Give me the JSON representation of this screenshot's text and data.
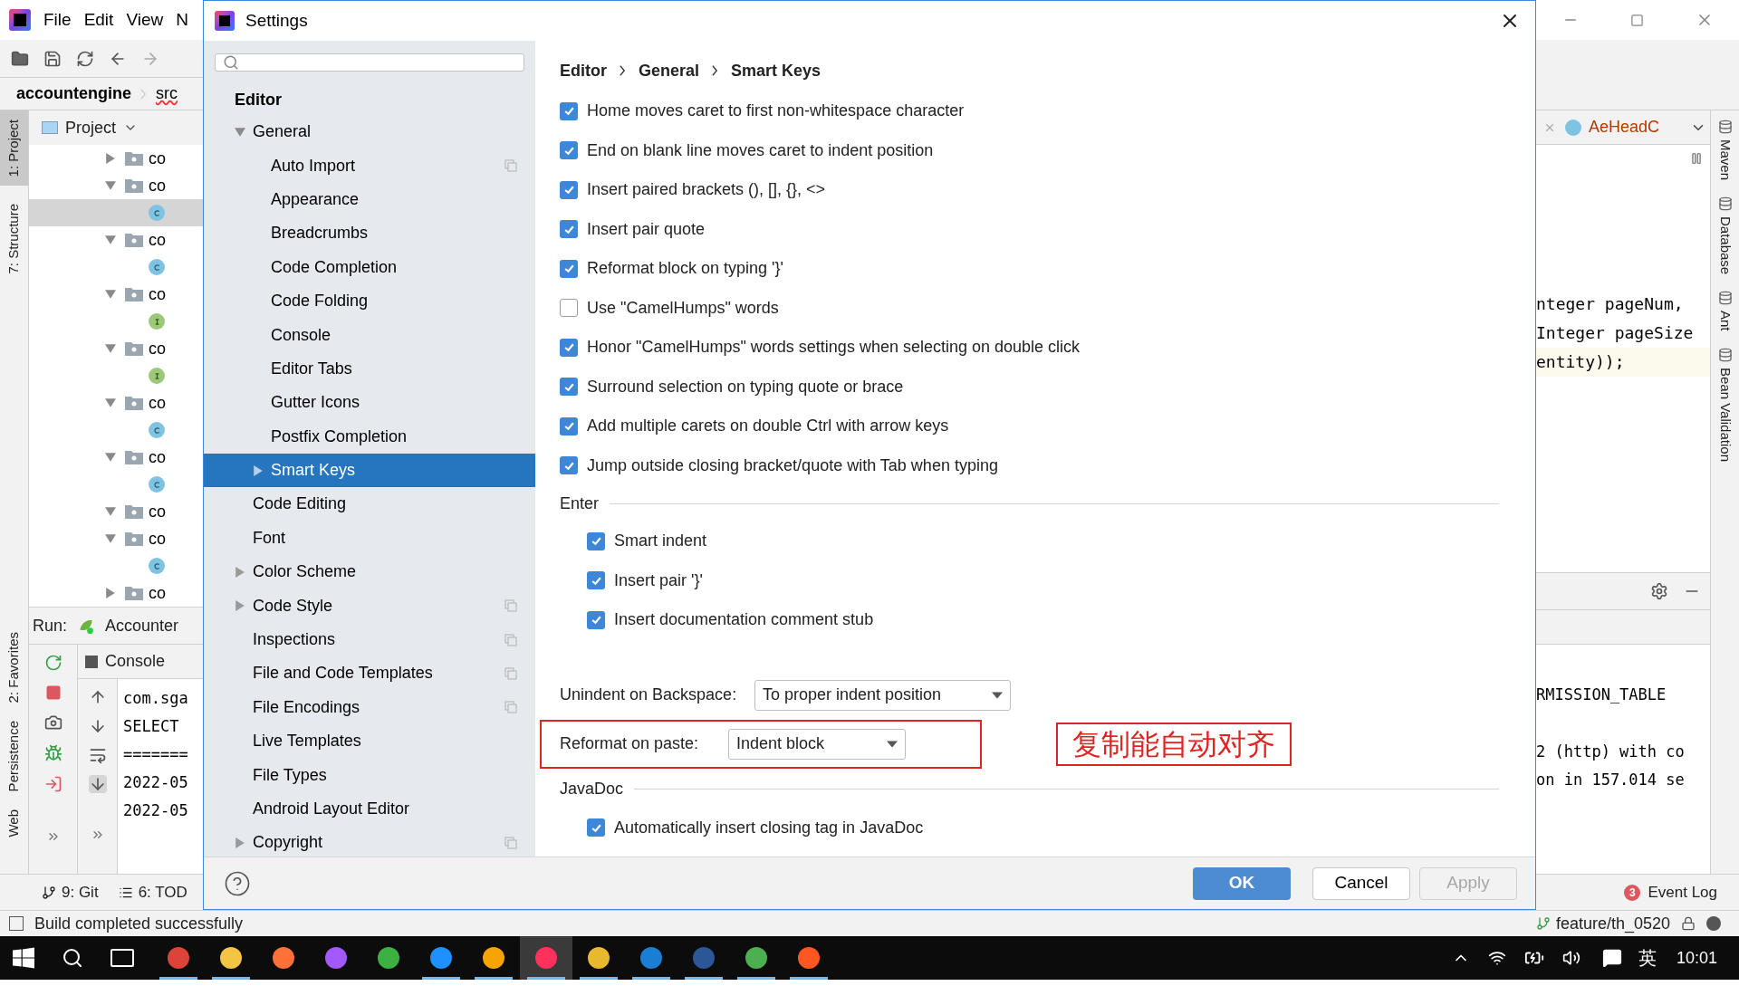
{
  "ide": {
    "menu": [
      "File",
      "Edit",
      "View",
      "N"
    ],
    "breadcrumbs": [
      "accountengine",
      "src"
    ],
    "left_stripe": [
      {
        "label": "1: Project",
        "selected": true
      },
      {
        "label": "7: Structure",
        "selected": false
      },
      {
        "label": "2: Favorites",
        "selected": false
      },
      {
        "label": "Persistence",
        "selected": false
      },
      {
        "label": "Web",
        "selected": false
      }
    ],
    "project_panel": {
      "title": "Project",
      "items": [
        {
          "kind": "folder",
          "label": "co",
          "expanded": false,
          "selected": false
        },
        {
          "kind": "folder",
          "label": "co",
          "expanded": true,
          "selected": false,
          "children": [
            {
              "kind": "class",
              "selected": true
            }
          ]
        },
        {
          "kind": "folder",
          "label": "co",
          "expanded": true,
          "selected": false,
          "children": [
            {
              "kind": "class",
              "selected": false
            }
          ]
        },
        {
          "kind": "folder",
          "label": "co",
          "expanded": true,
          "selected": false,
          "children": [
            {
              "kind": "interface",
              "selected": false
            }
          ]
        },
        {
          "kind": "folder",
          "label": "co",
          "expanded": true,
          "selected": false,
          "children": [
            {
              "kind": "interface",
              "selected": false
            }
          ]
        },
        {
          "kind": "folder",
          "label": "co",
          "expanded": true,
          "selected": false,
          "children": [
            {
              "kind": "class",
              "selected": false
            }
          ]
        },
        {
          "kind": "folder",
          "label": "co",
          "expanded": true,
          "selected": false,
          "children": [
            {
              "kind": "class",
              "selected": false
            }
          ]
        },
        {
          "kind": "folder",
          "label": "co",
          "expanded": true,
          "selected": false
        },
        {
          "kind": "folder",
          "label": "co",
          "expanded": true,
          "selected": false,
          "children": [
            {
              "kind": "class",
              "selected": false
            }
          ]
        },
        {
          "kind": "folder",
          "label": "co",
          "expanded": false,
          "selected": false
        }
      ]
    },
    "run": {
      "label": "Run:",
      "config": "Accounter",
      "console_tab": "Console",
      "lines": [
        "com.sga",
        "SELECT",
        "=======",
        "2022-05",
        "2022-05"
      ]
    },
    "bottom_tabs": [
      "9: Git",
      "6: TOD"
    ],
    "editor": {
      "tab": "AeHeadC",
      "code": [
        "nteger pageNum,",
        "Integer pageSize",
        "entity));"
      ]
    },
    "right_stripe": [
      "Maven",
      "Database",
      "Ant",
      "Bean Validation"
    ],
    "console_right": [
      "RMISSION_TABLE",
      "2 (http) with co",
      "on in 157.014 se"
    ],
    "event_log": {
      "count": "3",
      "label": "Event Log"
    },
    "status": {
      "message": "Build completed successfully",
      "branch": "feature/th_0520"
    }
  },
  "dialog": {
    "title": "Settings",
    "tree": {
      "heading": "Editor",
      "items": [
        {
          "label": "General",
          "expanded": true,
          "selected": false,
          "shared": false,
          "children": [
            {
              "label": "Auto Import",
              "selected": false,
              "shared": true
            },
            {
              "label": "Appearance",
              "selected": false,
              "shared": false
            },
            {
              "label": "Breadcrumbs",
              "selected": false,
              "shared": false
            },
            {
              "label": "Code Completion",
              "selected": false,
              "shared": false
            },
            {
              "label": "Code Folding",
              "selected": false,
              "shared": false
            },
            {
              "label": "Console",
              "selected": false,
              "shared": false
            },
            {
              "label": "Editor Tabs",
              "selected": false,
              "shared": false
            },
            {
              "label": "Gutter Icons",
              "selected": false,
              "shared": false
            },
            {
              "label": "Postfix Completion",
              "selected": false,
              "shared": false
            },
            {
              "label": "Smart Keys",
              "expanded": false,
              "selected": true,
              "shared": false
            }
          ]
        },
        {
          "label": "Code Editing",
          "selected": false,
          "shared": false
        },
        {
          "label": "Font",
          "selected": false,
          "shared": false
        },
        {
          "label": "Color Scheme",
          "expanded": false,
          "selected": false,
          "shared": false
        },
        {
          "label": "Code Style",
          "expanded": false,
          "selected": false,
          "shared": true
        },
        {
          "label": "Inspections",
          "selected": false,
          "shared": true
        },
        {
          "label": "File and Code Templates",
          "selected": false,
          "shared": true
        },
        {
          "label": "File Encodings",
          "selected": false,
          "shared": true
        },
        {
          "label": "Live Templates",
          "selected": false,
          "shared": false
        },
        {
          "label": "File Types",
          "selected": false,
          "shared": false
        },
        {
          "label": "Android Layout Editor",
          "selected": false,
          "shared": false
        },
        {
          "label": "Copyright",
          "expanded": false,
          "selected": false,
          "shared": true
        }
      ]
    },
    "breadcrumb": [
      "Editor",
      "General",
      "Smart Keys"
    ],
    "options": [
      {
        "label": "Home moves caret to first non-whitespace character",
        "checked": true
      },
      {
        "label": "End on blank line moves caret to indent position",
        "checked": true
      },
      {
        "label": "Insert paired brackets (), [], {}, <>",
        "checked": true
      },
      {
        "label": "Insert pair quote",
        "checked": true
      },
      {
        "label": "Reformat block on typing '}'",
        "checked": true
      },
      {
        "label": "Use \"CamelHumps\" words",
        "checked": false
      },
      {
        "label": "Honor \"CamelHumps\" words settings when selecting on double click",
        "checked": true
      },
      {
        "label": "Surround selection on typing quote or brace",
        "checked": true
      },
      {
        "label": "Add multiple carets on double Ctrl with arrow keys",
        "checked": true
      },
      {
        "label": "Jump outside closing bracket/quote with Tab when typing",
        "checked": true
      }
    ],
    "enter": {
      "title": "Enter",
      "options": [
        {
          "label": "Smart indent",
          "checked": true
        },
        {
          "label": "Insert pair '}'",
          "checked": true
        },
        {
          "label": "Insert documentation comment stub",
          "checked": true
        }
      ]
    },
    "unindent": {
      "label": "Unindent on Backspace:",
      "value": "To proper indent position"
    },
    "reformat": {
      "label": "Reformat on paste:",
      "value": "Indent block",
      "highlighted": true
    },
    "annotation": "复制能自动对齐",
    "javadoc": {
      "title": "JavaDoc",
      "options": [
        {
          "label": "Automatically insert closing tag in JavaDoc",
          "checked": true
        }
      ]
    },
    "buttons": [
      {
        "label": "OK",
        "kind": "primary",
        "disabled": false
      },
      {
        "label": "Cancel",
        "kind": "normal",
        "disabled": false
      },
      {
        "label": "Apply",
        "kind": "normal",
        "disabled": true
      }
    ]
  },
  "taskbar": {
    "apps": [
      {
        "color": "#db4437",
        "running": true,
        "active": false
      },
      {
        "color": "#f4c542",
        "running": true,
        "active": false
      },
      {
        "color": "#ff7139",
        "running": false,
        "active": false
      },
      {
        "color": "#a259ff",
        "running": false,
        "active": false
      },
      {
        "color": "#3cb043",
        "running": false,
        "active": false
      },
      {
        "color": "#1e90ff",
        "running": true,
        "active": false
      },
      {
        "color": "#f7a400",
        "running": true,
        "active": false
      },
      {
        "color": "#fe315d",
        "running": true,
        "active": true
      },
      {
        "color": "#e8b92f",
        "running": true,
        "active": false
      },
      {
        "color": "#1a7fd4",
        "running": true,
        "active": false
      },
      {
        "color": "#2b5797",
        "running": true,
        "active": false
      },
      {
        "color": "#4caf50",
        "running": true,
        "active": false
      },
      {
        "color": "#ff5722",
        "running": true,
        "active": false
      }
    ],
    "ime": "英",
    "time": "10:01"
  }
}
